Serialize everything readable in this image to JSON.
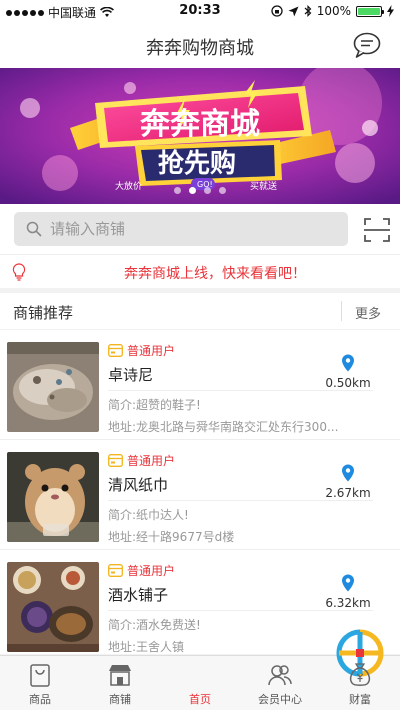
{
  "status_bar": {
    "carrier": "中国联通",
    "time": "20:33",
    "battery": "100%",
    "battery_level": 1.0
  },
  "nav": {
    "title": "奔奔购物商城",
    "message_icon": "chat-bubble-icon"
  },
  "banner": {
    "headline": "奔奔商城",
    "subline": "抢先购",
    "tag_left": "大放价",
    "tag_mid": "GO!",
    "tag_right": "买就送",
    "slide_count": 4,
    "active_slide": 1
  },
  "search": {
    "placeholder": "请输入商铺",
    "value": "",
    "scan_icon": "scan-icon"
  },
  "notice": {
    "text": "奔奔商城上线，快来看看吧！"
  },
  "section": {
    "title": "商铺推荐",
    "more": "更多"
  },
  "shops": [
    {
      "badge": "普通用户",
      "name": "卓诗尼",
      "intro": "简介:超赞的鞋子!",
      "address": "地址:龙奥北路与舜华南路交汇处东行300...",
      "distance": "0.50km"
    },
    {
      "badge": "普通用户",
      "name": "清风纸巾",
      "intro": "简介:纸巾达人!",
      "address": "地址:经十路9677号d楼",
      "distance": "2.67km"
    },
    {
      "badge": "普通用户",
      "name": "酒水铺子",
      "intro": "简介:酒水免费送!",
      "address": "地址:王舍人镇",
      "distance": "6.32km"
    }
  ],
  "tabs": [
    {
      "label": "商品",
      "icon": "bag-icon"
    },
    {
      "label": "商铺",
      "icon": "store-icon"
    },
    {
      "label": "首页",
      "icon": "home-logo-icon"
    },
    {
      "label": "会员中心",
      "icon": "members-icon"
    },
    {
      "label": "财富",
      "icon": "money-bag-icon"
    }
  ],
  "colors": {
    "accent": "#e8343a",
    "location_pin": "#1e8be0",
    "badge_yellow": "#f2b51d"
  }
}
